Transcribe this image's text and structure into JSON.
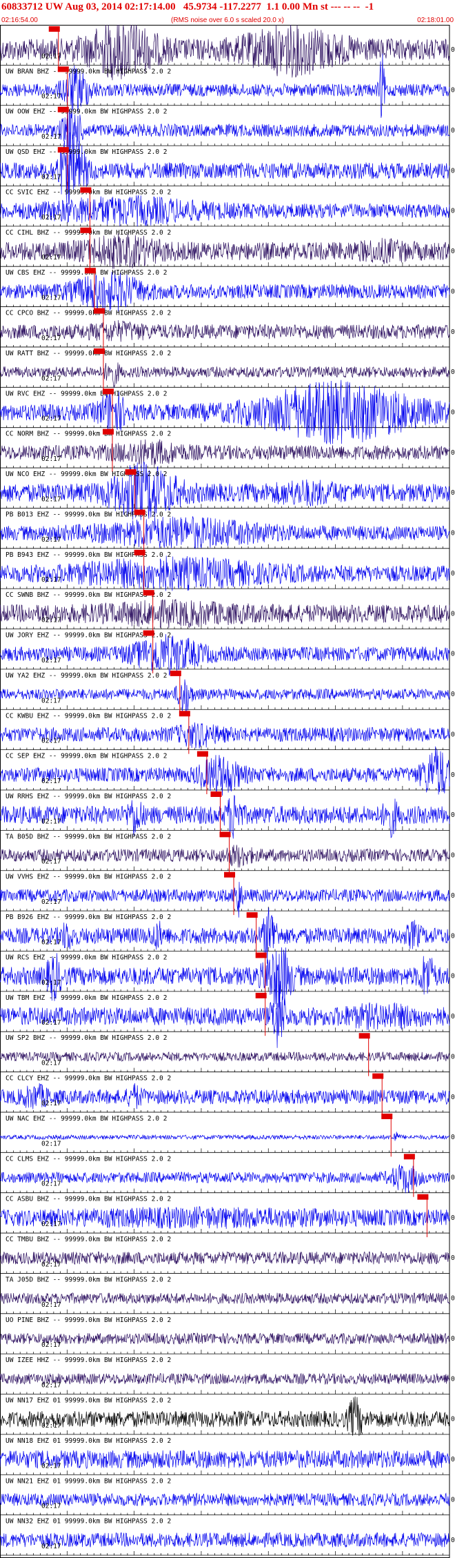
{
  "header": {
    "title": "60833712 UW Aug 03, 2014 02:17:14.00   45.9734 -117.2277  1.1 0.00 Mn st --- -- --  -1",
    "subtitle": "(RMS noise over 6.0 s scaled 20.0 x)",
    "start_time": "02:16:54.00",
    "end_time": "02:18:01.00"
  },
  "colors": {
    "trace_blue": "#0000ee",
    "trace_navy": "#2a0d5e",
    "trace_black": "#000000",
    "pick_red": "#e00000",
    "axis": "#000000"
  },
  "chart_data": {
    "type": "line",
    "title": "60833712 UW Aug 03, 2014 02:17:14.00   45.9734 -117.2277  1.1 0.00 Mn st --- -- --  -1",
    "x_axis": {
      "start": "02:16:54.00",
      "end": "02:18:01.00",
      "units": "time"
    },
    "time_label": "02:17",
    "traces": [
      {
        "label": "",
        "color": "navy",
        "amp": 0.6,
        "pick": 0.13,
        "bursts": [
          [
            0.27,
            0.05,
            3.0
          ],
          [
            0.65,
            0.07,
            2.6
          ]
        ]
      },
      {
        "label": "UW BRAN BHZ -- 99999.0km BW  HIGHPASS  2.0  2",
        "color": "blue",
        "amp": 0.35,
        "pick": 0.15,
        "bursts": [
          [
            0.17,
            0.02,
            4
          ],
          [
            0.85,
            0.004,
            6
          ]
        ]
      },
      {
        "label": "UW OOW EHZ -- 99999.0km BW  HIGHPASS  2.0  2",
        "color": "blue",
        "amp": 0.35,
        "pick": 0.15,
        "bursts": [
          [
            0.16,
            0.015,
            4
          ]
        ]
      },
      {
        "label": "UW QSD EHZ -- 99999.0km BW  HIGHPASS  2.0  2",
        "color": "blue",
        "amp": 0.45,
        "pick": 0.15,
        "bursts": [
          [
            0.16,
            0.02,
            5
          ]
        ]
      },
      {
        "label": "CC SVIC EHZ -- 99999.0km BW  HIGHPASS  2.0  2",
        "color": "blue",
        "amp": 0.4,
        "pick": 0.2,
        "bursts": [
          [
            0.28,
            0.12,
            2.2
          ]
        ]
      },
      {
        "label": "CC CIHL BHZ -- 99999.0km BW  HIGHPASS  2.0  2",
        "color": "navy",
        "amp": 0.5,
        "pick": 0.2,
        "bursts": [
          [
            0.27,
            0.06,
            2
          ],
          [
            0.85,
            0.04,
            1.5
          ]
        ]
      },
      {
        "label": "UW CBS EHZ -- 99999.0km BW  HIGHPASS  2.0  2",
        "color": "blue",
        "amp": 0.4,
        "pick": 0.21,
        "bursts": [
          [
            0.24,
            0.05,
            3
          ]
        ]
      },
      {
        "label": "CC CPCO BHZ -- 99999.0km BW  HIGHPASS  2.0  2",
        "color": "navy",
        "amp": 0.4,
        "pick": 0.23,
        "bursts": [
          [
            0.26,
            0.04,
            1.6
          ]
        ]
      },
      {
        "label": "UW RATT BHZ -- 99999.0km BW  HIGHPASS  2.0  2",
        "color": "navy",
        "amp": 0.3,
        "pick": 0.23,
        "bursts": [
          [
            0.25,
            0.01,
            3
          ]
        ]
      },
      {
        "label": "UW RVC EHZ -- 99999.0km BW  HIGHPASS  2.0  2",
        "color": "blue",
        "amp": 0.45,
        "pick": 0.25,
        "bursts": [
          [
            0.25,
            0.02,
            3
          ],
          [
            0.75,
            0.12,
            4
          ]
        ]
      },
      {
        "label": "CC NORM BHZ -- 99999.0km BW  HIGHPASS  2.0  2",
        "color": "navy",
        "amp": 0.4,
        "pick": 0.25,
        "bursts": [
          [
            0.33,
            0.05,
            2
          ]
        ]
      },
      {
        "label": "UW NCO EHZ -- 99999.0km BW  HIGHPASS  2.0  2",
        "color": "blue",
        "amp": 0.5,
        "pick": 0.3,
        "bursts": [
          [
            0.32,
            0.05,
            3.5
          ],
          [
            0.68,
            0.05,
            1.6
          ]
        ]
      },
      {
        "label": "PB B013 EHZ -- 99999.0km BW  HIGHPASS  2.0  2",
        "color": "blue",
        "amp": 0.4,
        "pick": 0.32,
        "bursts": [
          [
            0.4,
            0.12,
            2.4
          ]
        ]
      },
      {
        "label": "PB B943 EHZ -- 99999.0km BW  HIGHPASS  2.0  2",
        "color": "blue",
        "amp": 0.45,
        "pick": 0.32,
        "bursts": [
          [
            0.38,
            0.14,
            2.2
          ]
        ]
      },
      {
        "label": "CC SWNB BHZ -- 99999.0km BW  HIGHPASS  2.0  2",
        "color": "navy",
        "amp": 0.5,
        "pick": 0.34,
        "bursts": [
          [
            0.38,
            0.1,
            1.6
          ]
        ]
      },
      {
        "label": "UW JORY EHZ -- 99999.0km BW  HIGHPASS  2.0  2",
        "color": "blue",
        "amp": 0.4,
        "pick": 0.34,
        "bursts": [
          [
            0.37,
            0.05,
            3
          ]
        ]
      },
      {
        "label": "UW YA2 EHZ -- 99999.0km BW  HIGHPASS  2.0  2",
        "color": "blue",
        "amp": 0.3,
        "pick": 0.4,
        "bursts": [
          [
            0.41,
            0.01,
            4
          ]
        ]
      },
      {
        "label": "CC KWBU EHZ -- 99999.0km BW  HIGHPASS  2.0  2",
        "color": "blue",
        "amp": 0.4,
        "pick": 0.42,
        "bursts": [
          [
            0.44,
            0.03,
            2
          ]
        ]
      },
      {
        "label": "CC SEP EHZ -- 99999.0km BW  HIGHPASS  2.0  2",
        "color": "blue",
        "amp": 0.4,
        "pick": 0.46,
        "bursts": [
          [
            0.49,
            0.03,
            3
          ],
          [
            0.97,
            0.02,
            4
          ]
        ]
      },
      {
        "label": "UW RRHS EHZ -- 99999.0km BW  HIGHPASS  2.0  2",
        "color": "blue",
        "amp": 0.5,
        "pick": 0.49,
        "bursts": [
          [
            0.52,
            0.01,
            3
          ],
          [
            0.3,
            0.01,
            2.5
          ],
          [
            0.87,
            0.01,
            2.5
          ]
        ]
      },
      {
        "label": "TA B05D BHZ -- 99999.0km BW  HIGHPASS  2.0  2",
        "color": "navy",
        "amp": 0.35,
        "pick": 0.51,
        "bursts": [
          [
            0.53,
            0.02,
            2
          ]
        ]
      },
      {
        "label": "UW VVHS EHZ -- 99999.0km BW  HIGHPASS  2.0  2",
        "color": "blue",
        "amp": 0.35,
        "pick": 0.52,
        "bursts": [
          [
            0.53,
            0.005,
            4
          ]
        ]
      },
      {
        "label": "PB B926 EHZ -- 99999.0km BW  HIGHPASS  2.0  2",
        "color": "blue",
        "amp": 0.45,
        "pick": 0.57,
        "bursts": [
          [
            0.6,
            0.01,
            4
          ],
          [
            0.15,
            0.01,
            2
          ],
          [
            0.35,
            0.01,
            2
          ],
          [
            0.92,
            0.01,
            2
          ]
        ]
      },
      {
        "label": "UW RCS EHZ -- 99999.0km BW  HIGHPASS  2.0  2",
        "color": "blue",
        "amp": 0.5,
        "pick": 0.59,
        "bursts": [
          [
            0.62,
            0.02,
            4
          ],
          [
            0.12,
            0.01,
            3
          ],
          [
            0.95,
            0.01,
            3
          ]
        ]
      },
      {
        "label": "UW TBM EHZ -- 99999.0km BW  HIGHPASS  2.0  2",
        "color": "blue",
        "amp": 0.5,
        "pick": 0.59,
        "bursts": [
          [
            0.62,
            0.01,
            4
          ],
          [
            0.85,
            0.06,
            1.6
          ]
        ]
      },
      {
        "label": "UW SP2 BHZ -- 99999.0km BW  HIGHPASS  2.0  2",
        "color": "navy",
        "amp": 0.25,
        "pick": 0.82,
        "bursts": []
      },
      {
        "label": "CC CLCY EHZ -- 99999.0km BW  HIGHPASS  2.0  2",
        "color": "blue",
        "amp": 0.4,
        "pick": 0.85,
        "bursts": [
          [
            0.08,
            0.02,
            2
          ],
          [
            0.3,
            0.01,
            2
          ]
        ]
      },
      {
        "label": "UW NAC EHZ -- 99999.0km BW  HIGHPASS  2.0  2",
        "color": "blue",
        "amp": 0.12,
        "pick": 0.87,
        "bursts": [
          [
            0.88,
            0.005,
            3
          ]
        ]
      },
      {
        "label": "CC CLMS EHZ -- 99999.0km BW  HIGHPASS  2.0  2",
        "color": "blue",
        "amp": 0.3,
        "pick": 0.92,
        "bursts": [
          [
            0.9,
            0.02,
            3
          ]
        ]
      },
      {
        "label": "CC ASBU BHZ -- 99999.0km BW  HIGHPASS  2.0  2",
        "color": "blue",
        "amp": 0.45,
        "pick": 0.95,
        "bursts": [
          [
            0.45,
            0.2,
            1.4
          ]
        ]
      },
      {
        "label": "CC TMBU BHZ -- 99999.0km BW  HIGHPASS  2.0  2",
        "color": "navy",
        "amp": 0.35,
        "pick": -1,
        "bursts": []
      },
      {
        "label": "TA J05D BHZ -- 99999.0km BW  HIGHPASS  2.0  2",
        "color": "navy",
        "amp": 0.3,
        "pick": -1,
        "bursts": []
      },
      {
        "label": "UO PINE BHZ -- 99999.0km BW  HIGHPASS  2.0  2",
        "color": "navy",
        "amp": 0.3,
        "pick": -1,
        "bursts": []
      },
      {
        "label": "UW IZEE HHZ -- 99999.0km BW  HIGHPASS  2.0  2",
        "color": "navy",
        "amp": 0.3,
        "pick": -1,
        "bursts": []
      },
      {
        "label": "UW NN17 EHZ 01 99999.0km BW  HIGHPASS  2.0  2",
        "color": "black",
        "amp": 0.45,
        "pick": -1,
        "bursts": [
          [
            0.79,
            0.01,
            3
          ]
        ]
      },
      {
        "label": "UW NN18 EHZ 01 99999.0km BW  HIGHPASS  2.0  2",
        "color": "blue",
        "amp": 0.5,
        "pick": -1,
        "bursts": []
      },
      {
        "label": "UW NN21 EHZ 01 99999.0km BW  HIGHPASS  2.0  2",
        "color": "blue",
        "amp": 0.35,
        "pick": -1,
        "bursts": []
      },
      {
        "label": "UW NN32 EHZ 01 99999.0km BW  HIGHPASS  2.0  2",
        "color": "blue",
        "amp": 0.4,
        "pick": -1,
        "bursts": []
      }
    ]
  }
}
